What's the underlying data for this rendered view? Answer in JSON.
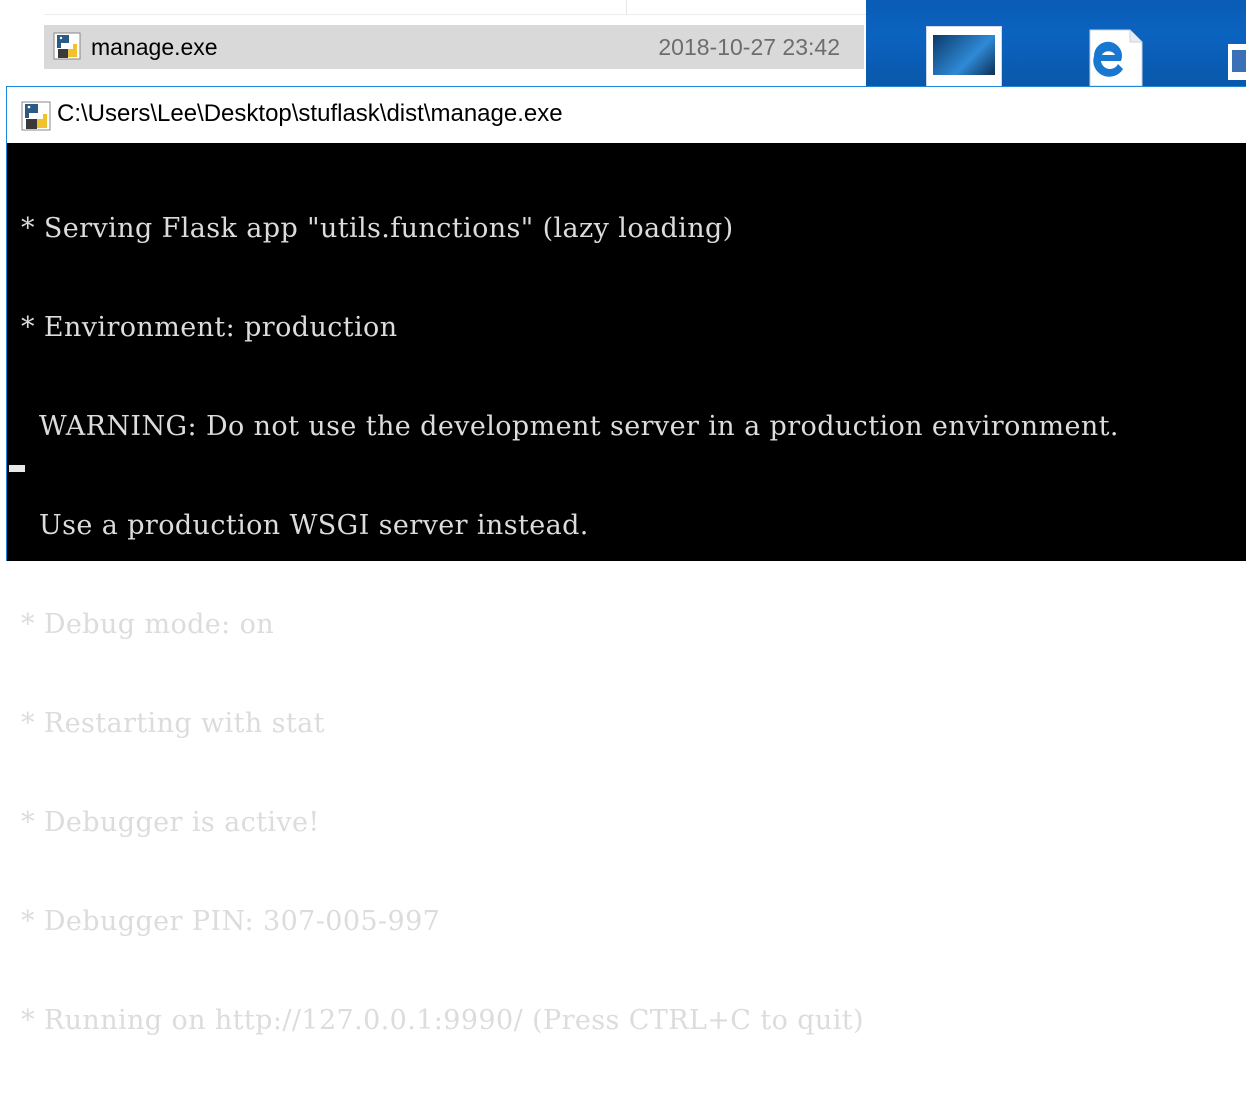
{
  "explorer": {
    "file": {
      "name": "manage.exe",
      "date": "2018-10-27 23:42"
    }
  },
  "console": {
    "title": "C:\\Users\\Lee\\Desktop\\stuflask\\dist\\manage.exe",
    "lines": [
      "* Serving Flask app \"utils.functions\" (lazy loading)",
      "* Environment: production",
      "  WARNING: Do not use the development server in a production environment.",
      "  Use a production WSGI server instead.",
      "* Debug mode: on",
      "* Restarting with stat",
      "* Debugger is active!",
      "* Debugger PIN: 307-005-997",
      "* Running on http://127.0.0.1:9990/ (Press CTRL+C to quit)"
    ]
  },
  "colors": {
    "console_bg": "#000000",
    "console_text": "#dcdcdc",
    "selection": "#d9d9d9",
    "desktop": "#0a5cb4"
  },
  "icons": [
    "python-exe-icon",
    "edge-icon",
    "document-thumbnail-icon",
    "cursor"
  ]
}
